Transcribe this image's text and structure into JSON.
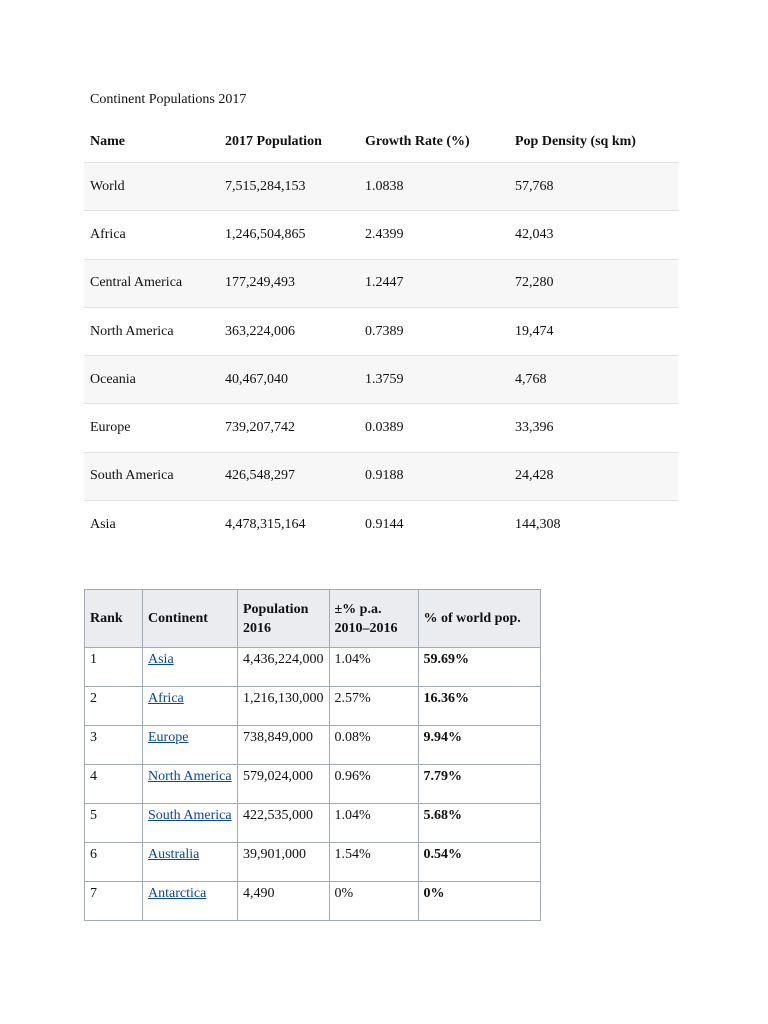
{
  "caption": "Continent Populations 2017",
  "table1": {
    "headers": [
      "Name",
      "2017 Population",
      "Growth Rate (%)",
      "Pop Density (sq km)"
    ],
    "rows": [
      [
        "World",
        "7,515,284,153",
        "1.0838",
        "57,768"
      ],
      [
        "Africa",
        "1,246,504,865",
        "2.4399",
        "42,043"
      ],
      [
        "Central America",
        "177,249,493",
        "1.2447",
        "72,280"
      ],
      [
        "North America",
        "363,224,006",
        "0.7389",
        "19,474"
      ],
      [
        "Oceania",
        "40,467,040",
        "1.3759",
        "4,768"
      ],
      [
        "Europe",
        "739,207,742",
        "0.0389",
        "33,396"
      ],
      [
        "South America",
        "426,548,297",
        "0.9188",
        "24,428"
      ],
      [
        "Asia",
        "4,478,315,164",
        "0.9144",
        "144,308"
      ]
    ]
  },
  "table2": {
    "headers": [
      "Rank",
      "Continent",
      "Population 2016",
      "±% p.a. 2010–2016",
      "% of world pop."
    ],
    "rows": [
      [
        "1",
        "Asia",
        "4,436,224,000",
        "1.04%",
        "59.69%"
      ],
      [
        "2",
        "Africa",
        "1,216,130,000",
        "2.57%",
        "16.36%"
      ],
      [
        "3",
        "Europe",
        "738,849,000",
        "0.08%",
        "9.94%"
      ],
      [
        "4",
        "North America",
        "579,024,000",
        "0.96%",
        "7.79%"
      ],
      [
        "5",
        "South America",
        "422,535,000",
        "1.04%",
        "5.68%"
      ],
      [
        "6",
        "Australia",
        "39,901,000",
        "1.54%",
        "0.54%"
      ],
      [
        "7",
        "Antarctica",
        "4,490",
        "0%",
        "0%"
      ]
    ]
  },
  "colors": {
    "link": "#0645ad",
    "header_bg": "#eaecf0",
    "row_shade": "#f7f7f7",
    "border": "#a2a9b1"
  }
}
